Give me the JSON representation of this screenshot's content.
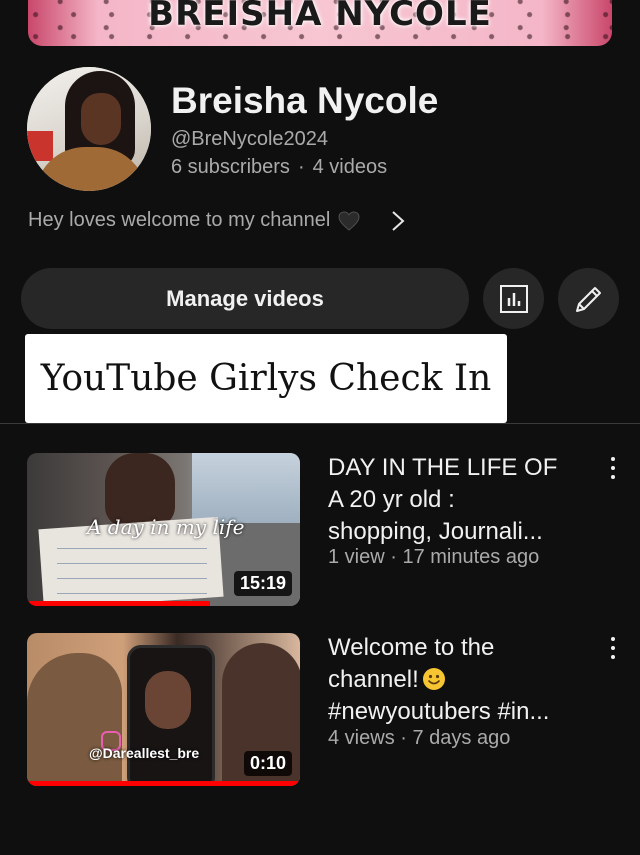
{
  "banner": {
    "title": "BREISHA NYCOLE"
  },
  "channel": {
    "name": "Breisha Nycole",
    "handle": "@BreNycole2024",
    "subscribers": "6 subscribers",
    "separator": "·",
    "video_count": "4 videos",
    "description": "Hey loves welcome to my channel"
  },
  "actions": {
    "manage_videos_label": "Manage videos",
    "analytics_icon": "analytics-icon",
    "edit_icon": "pencil-icon"
  },
  "sticker": {
    "text": "YouTube Girlys Check In"
  },
  "videos": [
    {
      "title_lines": [
        "DAY IN THE LIFE OF",
        "A 20 yr old :",
        "shopping, Journali..."
      ],
      "meta": "1 view · 17 minutes ago",
      "duration": "15:19",
      "thumbnail_text": "A day in my life",
      "watched_fraction": 0.67
    },
    {
      "title_lines": [
        "Welcome to the",
        "channel!",
        "#newyoutubers #in..."
      ],
      "meta": "4 views · 7 days ago",
      "duration": "0:10",
      "thumbnail_text": "@Dareallest_bre",
      "watched_fraction": 1.0
    }
  ],
  "colors": {
    "background": "#0f0f0f",
    "button_bg": "#272727",
    "secondary_text": "#aaaaaa",
    "progress": "#ff0000"
  }
}
